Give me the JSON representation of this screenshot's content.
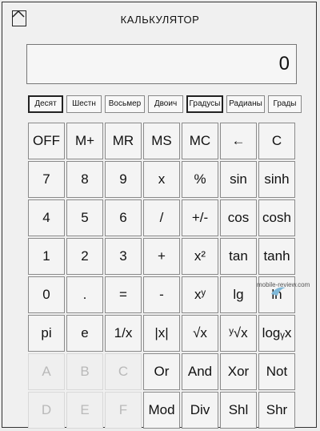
{
  "header": {
    "title": "КАЛЬКУЛЯТОР",
    "home_icon": "home-icon"
  },
  "display": {
    "value": "0"
  },
  "modes": [
    {
      "label": "Десят",
      "active": true
    },
    {
      "label": "Шестн",
      "active": false
    },
    {
      "label": "Восьмер",
      "active": false
    },
    {
      "label": "Двоич",
      "active": false
    },
    {
      "label": "Градусы",
      "active": true
    },
    {
      "label": "Радианы",
      "active": false
    },
    {
      "label": "Грады",
      "active": false
    }
  ],
  "keys": [
    [
      "OFF",
      "M+",
      "MR",
      "MS",
      "MC",
      "←",
      "C"
    ],
    [
      "7",
      "8",
      "9",
      "x",
      "%",
      "sin",
      "sinh"
    ],
    [
      "4",
      "5",
      "6",
      "/",
      "+/-",
      "cos",
      "cosh"
    ],
    [
      "1",
      "2",
      "3",
      "+",
      "x²",
      "tan",
      "tanh"
    ],
    [
      "0",
      ".",
      "=",
      "-",
      "xʸ",
      "lg",
      "ln"
    ],
    [
      "pi",
      "e",
      "1/x",
      "|x|",
      "√x",
      "ʸ√x",
      "logᵧx"
    ],
    [
      "A",
      "B",
      "C",
      "Or",
      "And",
      "Xor",
      "Not"
    ],
    [
      "D",
      "E",
      "F",
      "Mod",
      "Div",
      "Shl",
      "Shr"
    ]
  ],
  "disabled_keys": [
    "A",
    "B",
    "C",
    "D",
    "E",
    "F"
  ],
  "watermark": "mobile-review.com"
}
